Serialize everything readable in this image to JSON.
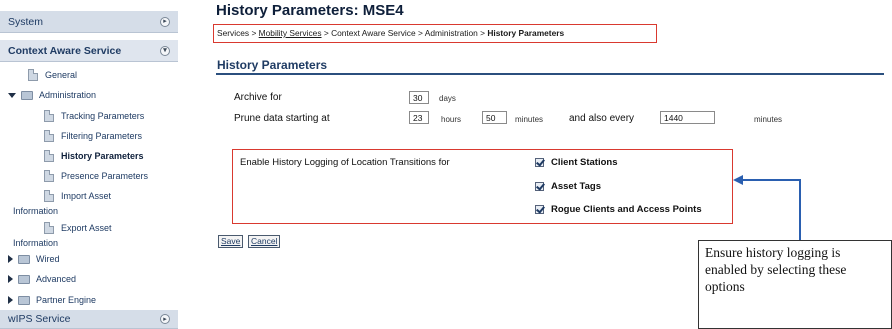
{
  "sidebar": {
    "system_label": "System",
    "context_aware_label": "Context Aware Service",
    "wips_label": "wIPS Service",
    "items": {
      "general": "General",
      "administration": "Administration",
      "tracking": "Tracking Parameters",
      "filtering": "Filtering Parameters",
      "history": "History Parameters",
      "presence": "Presence Parameters",
      "import_asset_1": "Import Asset",
      "import_asset_2": "Information",
      "export_asset_1": "Export Asset",
      "export_asset_2": "Information",
      "wired": "Wired",
      "advanced": "Advanced",
      "partner_engine": "Partner Engine"
    }
  },
  "main": {
    "title": "History Parameters: MSE4",
    "breadcrumb": {
      "services": "Services",
      "sep": " > ",
      "mobility": "Mobility Services",
      "context": "Context Aware Service",
      "administration": "Administration",
      "current": "History Parameters"
    },
    "section_title": "History Parameters",
    "archive_label": "Archive for",
    "archive_value": "30",
    "archive_unit": "days",
    "prune_label": "Prune data starting at",
    "prune_hours_value": "23",
    "prune_hours_unit": "hours",
    "prune_minutes_value": "50",
    "prune_minutes_unit": "minutes",
    "every_label": "and also every",
    "every_value": "1440",
    "every_unit": "minutes",
    "logging_label": "Enable History Logging of Location Transitions for",
    "options": {
      "client_stations": "Client Stations",
      "asset_tags": "Asset Tags",
      "rogue": "Rogue Clients and Access Points"
    },
    "save_label": "Save",
    "cancel_label": "Cancel"
  },
  "callout": {
    "text": "Ensure history logging is enabled by selecting these options"
  },
  "colors": {
    "highlight_red": "#d9392f",
    "nav_blue": "#1f3b63",
    "arrow_blue": "#2a5fb0"
  }
}
